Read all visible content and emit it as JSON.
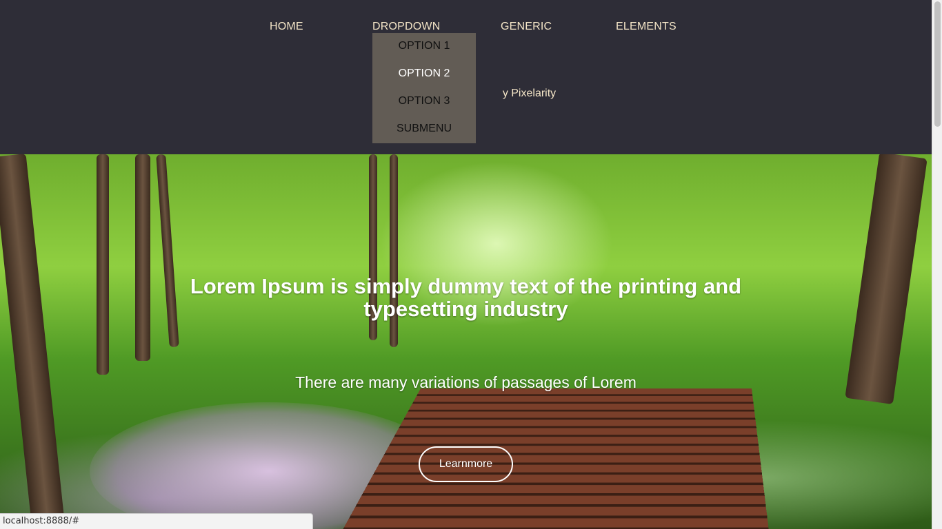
{
  "nav": {
    "items": [
      {
        "label": "HOME"
      },
      {
        "label": "DROPDOWN"
      },
      {
        "label": "GENERIC"
      },
      {
        "label": "ELEMENTS"
      }
    ],
    "dropdown_options": [
      {
        "label": "OPTION 1"
      },
      {
        "label": "OPTION 2"
      },
      {
        "label": "OPTION 3"
      },
      {
        "label": "SUBMENU"
      }
    ]
  },
  "header": {
    "tagline_partial": "y Pixelarity"
  },
  "hero": {
    "title": "Lorem Ipsum is simply dummy text of the printing and typesetting industry",
    "subtitle": "There are many variations of passages of Lorem",
    "button_label": "Learnmore"
  },
  "status_bar": {
    "url": "localhost:8888/#"
  },
  "colors": {
    "header_bg": "#2e2d37",
    "nav_text": "#f5e6c8",
    "dropdown_bg": "#625c55"
  }
}
